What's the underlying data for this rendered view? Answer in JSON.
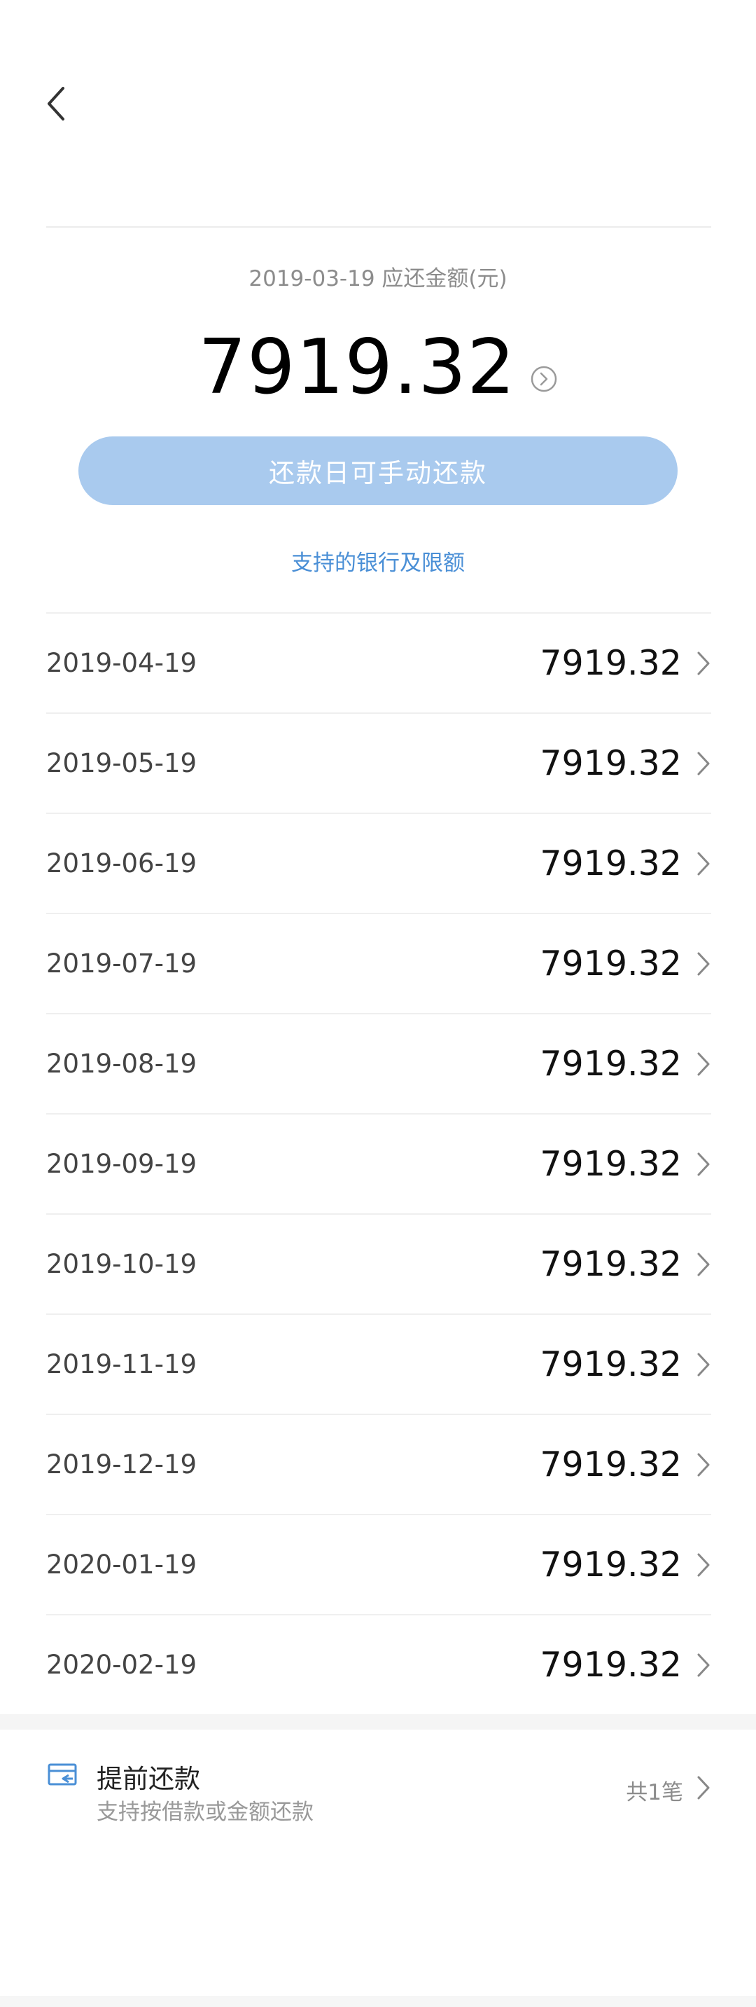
{
  "header": {
    "back_icon": "chevron-left-icon"
  },
  "summary": {
    "due_label": "2019-03-19 应还金额(元)",
    "amount": "7919.32",
    "pay_button": "还款日可手动还款",
    "banks_link": "支持的银行及限额",
    "colors": {
      "button_bg": "#a9caee",
      "link": "#4a8fd6"
    }
  },
  "schedule": [
    {
      "date": "2019-04-19",
      "amount": "7919.32"
    },
    {
      "date": "2019-05-19",
      "amount": "7919.32"
    },
    {
      "date": "2019-06-19",
      "amount": "7919.32"
    },
    {
      "date": "2019-07-19",
      "amount": "7919.32"
    },
    {
      "date": "2019-08-19",
      "amount": "7919.32"
    },
    {
      "date": "2019-09-19",
      "amount": "7919.32"
    },
    {
      "date": "2019-10-19",
      "amount": "7919.32"
    },
    {
      "date": "2019-11-19",
      "amount": "7919.32"
    },
    {
      "date": "2019-12-19",
      "amount": "7919.32"
    },
    {
      "date": "2020-01-19",
      "amount": "7919.32"
    },
    {
      "date": "2020-02-19",
      "amount": "7919.32"
    }
  ],
  "prepay": {
    "icon": "card-refund-icon",
    "title": "提前还款",
    "subtitle": "支持按借款或金额还款",
    "count": "共1笔"
  }
}
